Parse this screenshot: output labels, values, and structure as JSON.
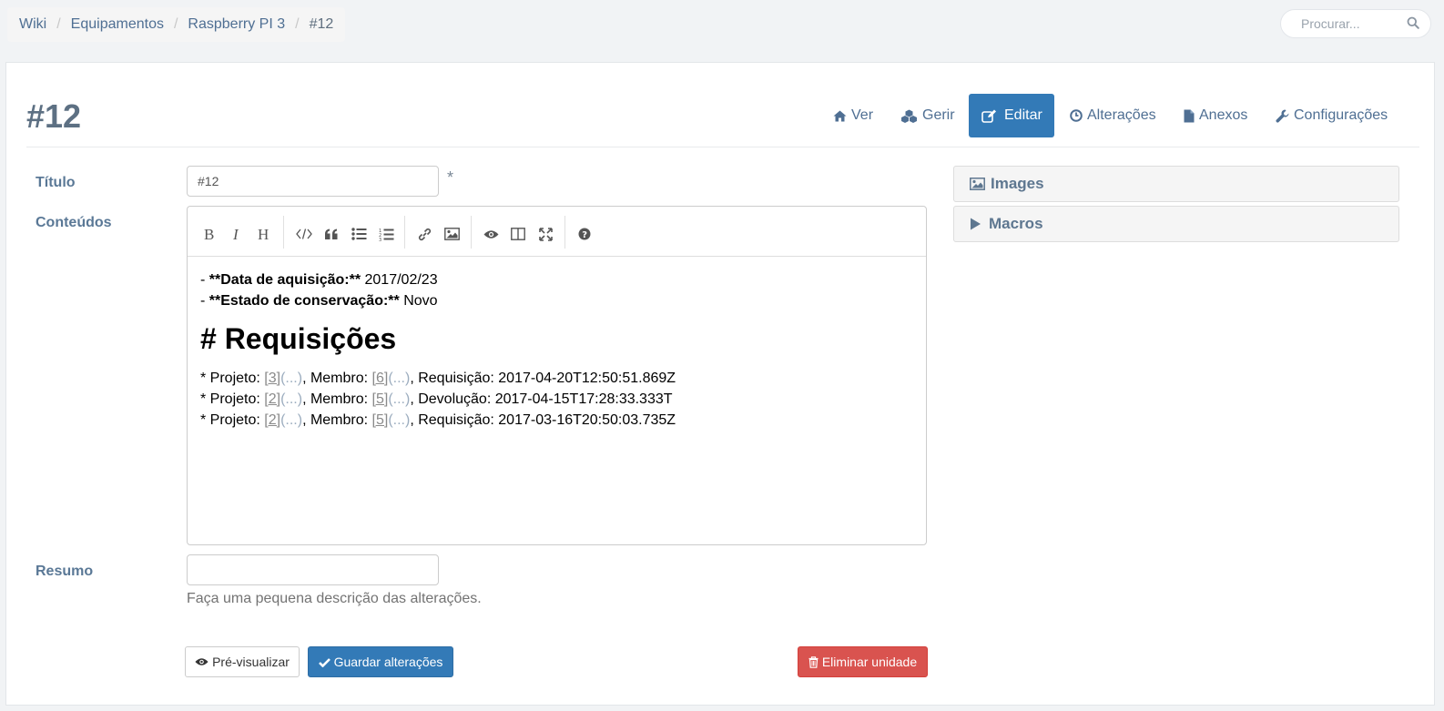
{
  "breadcrumb": {
    "items": [
      "Wiki",
      "Equipamentos",
      "Raspberry PI 3"
    ],
    "active": "#12",
    "separator": "/"
  },
  "search": {
    "placeholder": "Procurar...",
    "icon": "search-icon"
  },
  "page": {
    "title": "#12"
  },
  "actions": [
    {
      "label": "Ver",
      "icon": "home-icon"
    },
    {
      "label": "Gerir",
      "icon": "cubes-icon"
    },
    {
      "label": "Editar",
      "icon": "edit-icon",
      "active": true
    },
    {
      "label": "Alterações",
      "icon": "clock-icon"
    },
    {
      "label": "Anexos",
      "icon": "file-icon"
    },
    {
      "label": "Configurações",
      "icon": "wrench-icon"
    }
  ],
  "form": {
    "title_label": "Título",
    "title_value": "#12",
    "required_mark": "*",
    "content_label": "Conteúdos",
    "summary_label": "Resumo",
    "summary_value": "",
    "summary_help": "Faça uma pequena descrição das alterações."
  },
  "editor": {
    "toolbar": [
      "bold",
      "italic",
      "heading",
      "code",
      "quote",
      "unordered-list",
      "ordered-list",
      "link",
      "image",
      "preview",
      "side-by-side",
      "fullscreen",
      "guide"
    ],
    "lines": {
      "l1_prefix": "- ",
      "l1_bold": "**Data de aquisição:**",
      "l1_value": " 2017/02/23",
      "l2_prefix": "- ",
      "l2_bold": "**Estado de conservação:**",
      "l2_value": " Novo",
      "heading": "# Requisições",
      "rows": [
        {
          "p": "* Projeto: ",
          "pref": "[3]",
          "pdots": "(...)",
          "m": ", Membro: ",
          "mref": "[6]",
          "mdots": "(...)",
          "rest": ", Requisição: 2017-04-20T12:50:51.869Z"
        },
        {
          "p": "* Projeto: ",
          "pref": "[2]",
          "pdots": "(...)",
          "m": ", Membro: ",
          "mref": "[5]",
          "mdots": "(...)",
          "rest": ", Devolução: 2017-04-15T17:28:33.333T"
        },
        {
          "p": "* Projeto: ",
          "pref": "[2]",
          "pdots": "(...)",
          "m": ", Membro: ",
          "mref": "[5]",
          "mdots": "(...)",
          "rest": ", Requisição: 2017-03-16T20:50:03.735Z"
        }
      ]
    }
  },
  "sidebar": {
    "images_label": "Images",
    "macros_label": "Macros"
  },
  "buttons": {
    "preview": "Pré-visualizar",
    "save": "Guardar alterações",
    "delete": "Eliminar unidade"
  },
  "colors": {
    "primary": "#337ab7",
    "danger": "#d9534f",
    "link": "#4f6f93"
  }
}
